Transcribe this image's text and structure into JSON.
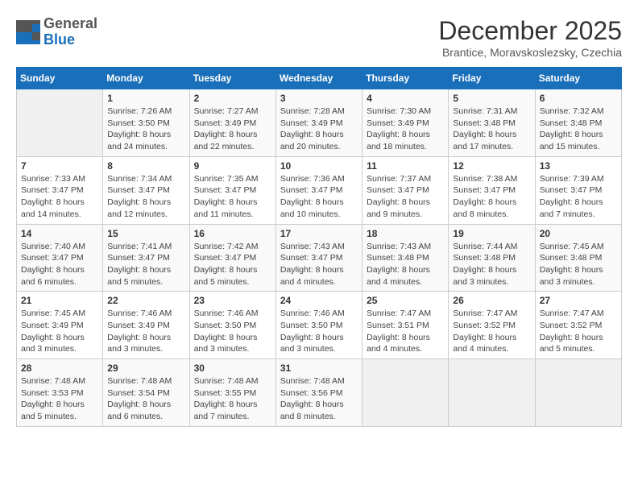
{
  "header": {
    "logo_general": "General",
    "logo_blue": "Blue",
    "title": "December 2025",
    "location": "Brantice, Moravskoslezsky, Czechia"
  },
  "weekdays": [
    "Sunday",
    "Monday",
    "Tuesday",
    "Wednesday",
    "Thursday",
    "Friday",
    "Saturday"
  ],
  "weeks": [
    [
      {
        "day": "",
        "sunrise": "",
        "sunset": "",
        "daylight": ""
      },
      {
        "day": "1",
        "sunrise": "7:26 AM",
        "sunset": "3:50 PM",
        "daylight": "8 hours and 24 minutes."
      },
      {
        "day": "2",
        "sunrise": "7:27 AM",
        "sunset": "3:49 PM",
        "daylight": "8 hours and 22 minutes."
      },
      {
        "day": "3",
        "sunrise": "7:28 AM",
        "sunset": "3:49 PM",
        "daylight": "8 hours and 20 minutes."
      },
      {
        "day": "4",
        "sunrise": "7:30 AM",
        "sunset": "3:49 PM",
        "daylight": "8 hours and 18 minutes."
      },
      {
        "day": "5",
        "sunrise": "7:31 AM",
        "sunset": "3:48 PM",
        "daylight": "8 hours and 17 minutes."
      },
      {
        "day": "6",
        "sunrise": "7:32 AM",
        "sunset": "3:48 PM",
        "daylight": "8 hours and 15 minutes."
      }
    ],
    [
      {
        "day": "7",
        "sunrise": "7:33 AM",
        "sunset": "3:47 PM",
        "daylight": "8 hours and 14 minutes."
      },
      {
        "day": "8",
        "sunrise": "7:34 AM",
        "sunset": "3:47 PM",
        "daylight": "8 hours and 12 minutes."
      },
      {
        "day": "9",
        "sunrise": "7:35 AM",
        "sunset": "3:47 PM",
        "daylight": "8 hours and 11 minutes."
      },
      {
        "day": "10",
        "sunrise": "7:36 AM",
        "sunset": "3:47 PM",
        "daylight": "8 hours and 10 minutes."
      },
      {
        "day": "11",
        "sunrise": "7:37 AM",
        "sunset": "3:47 PM",
        "daylight": "8 hours and 9 minutes."
      },
      {
        "day": "12",
        "sunrise": "7:38 AM",
        "sunset": "3:47 PM",
        "daylight": "8 hours and 8 minutes."
      },
      {
        "day": "13",
        "sunrise": "7:39 AM",
        "sunset": "3:47 PM",
        "daylight": "8 hours and 7 minutes."
      }
    ],
    [
      {
        "day": "14",
        "sunrise": "7:40 AM",
        "sunset": "3:47 PM",
        "daylight": "8 hours and 6 minutes."
      },
      {
        "day": "15",
        "sunrise": "7:41 AM",
        "sunset": "3:47 PM",
        "daylight": "8 hours and 5 minutes."
      },
      {
        "day": "16",
        "sunrise": "7:42 AM",
        "sunset": "3:47 PM",
        "daylight": "8 hours and 5 minutes."
      },
      {
        "day": "17",
        "sunrise": "7:43 AM",
        "sunset": "3:47 PM",
        "daylight": "8 hours and 4 minutes."
      },
      {
        "day": "18",
        "sunrise": "7:43 AM",
        "sunset": "3:48 PM",
        "daylight": "8 hours and 4 minutes."
      },
      {
        "day": "19",
        "sunrise": "7:44 AM",
        "sunset": "3:48 PM",
        "daylight": "8 hours and 3 minutes."
      },
      {
        "day": "20",
        "sunrise": "7:45 AM",
        "sunset": "3:48 PM",
        "daylight": "8 hours and 3 minutes."
      }
    ],
    [
      {
        "day": "21",
        "sunrise": "7:45 AM",
        "sunset": "3:49 PM",
        "daylight": "8 hours and 3 minutes."
      },
      {
        "day": "22",
        "sunrise": "7:46 AM",
        "sunset": "3:49 PM",
        "daylight": "8 hours and 3 minutes."
      },
      {
        "day": "23",
        "sunrise": "7:46 AM",
        "sunset": "3:50 PM",
        "daylight": "8 hours and 3 minutes."
      },
      {
        "day": "24",
        "sunrise": "7:46 AM",
        "sunset": "3:50 PM",
        "daylight": "8 hours and 3 minutes."
      },
      {
        "day": "25",
        "sunrise": "7:47 AM",
        "sunset": "3:51 PM",
        "daylight": "8 hours and 4 minutes."
      },
      {
        "day": "26",
        "sunrise": "7:47 AM",
        "sunset": "3:52 PM",
        "daylight": "8 hours and 4 minutes."
      },
      {
        "day": "27",
        "sunrise": "7:47 AM",
        "sunset": "3:52 PM",
        "daylight": "8 hours and 5 minutes."
      }
    ],
    [
      {
        "day": "28",
        "sunrise": "7:48 AM",
        "sunset": "3:53 PM",
        "daylight": "8 hours and 5 minutes."
      },
      {
        "day": "29",
        "sunrise": "7:48 AM",
        "sunset": "3:54 PM",
        "daylight": "8 hours and 6 minutes."
      },
      {
        "day": "30",
        "sunrise": "7:48 AM",
        "sunset": "3:55 PM",
        "daylight": "8 hours and 7 minutes."
      },
      {
        "day": "31",
        "sunrise": "7:48 AM",
        "sunset": "3:56 PM",
        "daylight": "8 hours and 8 minutes."
      },
      {
        "day": "",
        "sunrise": "",
        "sunset": "",
        "daylight": ""
      },
      {
        "day": "",
        "sunrise": "",
        "sunset": "",
        "daylight": ""
      },
      {
        "day": "",
        "sunrise": "",
        "sunset": "",
        "daylight": ""
      }
    ]
  ]
}
